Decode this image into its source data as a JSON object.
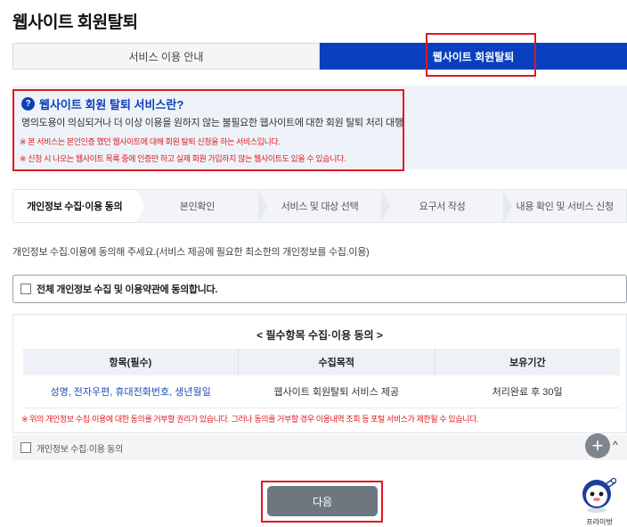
{
  "page": {
    "title": "웹사이트 회원탈퇴"
  },
  "tabs": [
    {
      "label": "서비스 이용 안내",
      "active": false
    },
    {
      "label": "웹사이트 회원탈퇴",
      "active": true
    }
  ],
  "info": {
    "icon": "question-icon",
    "title": "웹사이트 회원 탈퇴 서비스란?",
    "description": "명의도용이 의심되거나 더 이상 이용을 원하지 않는 불필요한 웹사이트에 대한 회원 탈퇴 처리 대행",
    "notes": [
      "※ 본 서비스는 본인인증 했던 웹사이트에 대해 회원 탈퇴 신청을 하는 서비스입니다.",
      "※ 신청 시 나오는 웹사이트 목록 중에 인증만 하고 실제 회원 가입하지 않는 웹사이트도 있을 수 있습니다."
    ]
  },
  "steps": [
    "개인정보 수집·이용 동의",
    "본인확인",
    "서비스 및 대상 선택",
    "요구서 작성",
    "내용 확인 및 서비스 신청"
  ],
  "instruction": "개인정보 수집.이용에 동의해 주세요.(서비스 제공에 필요한 최소한의 개인정보를 수집.이용)",
  "agree_all": {
    "label": "전체 개인정보 수집 및 이용약관에 동의합니다.",
    "checked": false
  },
  "required": {
    "title": "< 필수항목 수집·이용 동의 >",
    "headers": [
      "항목(필수)",
      "수집목적",
      "보유기간"
    ],
    "row": [
      "성명, 전자우편, 휴대전화번호, 생년월일",
      "웹사이트 회원탈퇴 서비스 제공",
      "처리완료 후 30일"
    ],
    "warning": "※ 위의 개인정보 수집·이용에 대한 동의를 거부할 권리가 있습니다. 그러나 동의를 거부할 경우 이용내역 조회 등 포털 서비스가 제한될 수 있습니다.",
    "consent_label": "개인정보 수집·이용 동의",
    "consent_checked": false
  },
  "floating": {
    "plus_icon": "plus-icon",
    "plus_symbol": "+",
    "caret_symbol": "^"
  },
  "next_button": "다음",
  "chatbot": {
    "label": "프라이벗"
  },
  "colors": {
    "accent": "#0a3fbf",
    "highlight": "#e0191f",
    "next_button": "#6e7680"
  }
}
